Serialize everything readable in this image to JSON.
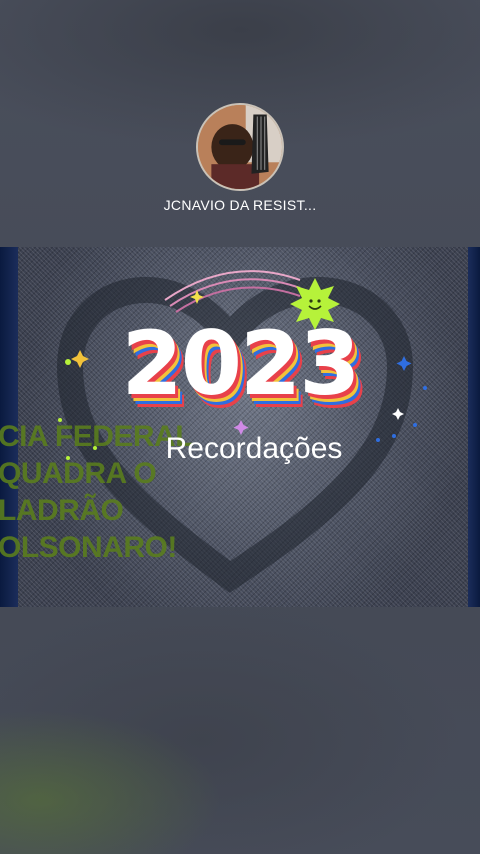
{
  "channel": {
    "name": "JCNAVIO DA RESIST..."
  },
  "video": {
    "year": "2023",
    "subtitle": "Recordações",
    "overlay_lines": [
      "CIA FEDERAL",
      "QUADRA O",
      "LADRÃO",
      "OLSONARO!"
    ]
  },
  "colors": {
    "background": "#464b58",
    "overlay_text": "#5a7d1e",
    "accent_red": "#e8414a",
    "accent_yellow": "#f2c23a",
    "accent_blue": "#2f6ee0",
    "sun_green": "#b6f23a"
  },
  "icons": {
    "avatar": "profile-photo",
    "sun": "smiling-sun-icon",
    "sparkles": "sparkle-icon"
  }
}
